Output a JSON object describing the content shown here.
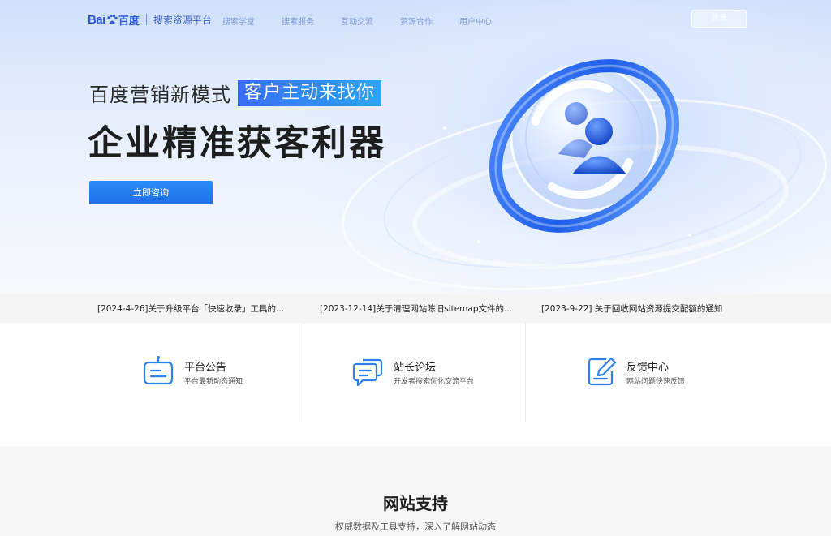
{
  "nav": {
    "logo_latin": "Bai",
    "logo_cn": "百度",
    "platform": "搜索资源平台",
    "links": [
      "搜索学堂",
      "搜索服务",
      "互动交流",
      "资源合作",
      "用户中心"
    ],
    "login": "登录"
  },
  "hero": {
    "line1": "百度营销新模式",
    "highlight": "客户主动来找你",
    "title": "企业精准获客利器",
    "cta": "立即咨询"
  },
  "notices": [
    "[2024-4-26]关于升级平台「快速收录」工具的...",
    "[2023-12-14]关于清理网站陈旧sitemap文件的...",
    "[2023-9-22] 关于回收网站资源提交配额的通知"
  ],
  "features": [
    {
      "title": "平台公告",
      "desc": "平台最新动态通知",
      "icon": "announcement-icon"
    },
    {
      "title": "站长论坛",
      "desc": "开发者搜索优化交流平台",
      "icon": "chat-bubbles-icon"
    },
    {
      "title": "反馈中心",
      "desc": "网站问题快速反馈",
      "icon": "edit-feedback-icon"
    }
  ],
  "support": {
    "title": "网站支持",
    "subtitle": "权威数据及工具支持，深入了解网站动态"
  },
  "colors": {
    "brand": "#2d5bd8",
    "accent": "#2f80ed",
    "highlight_start": "#3a6df6",
    "highlight_end": "#2aa6f2"
  }
}
